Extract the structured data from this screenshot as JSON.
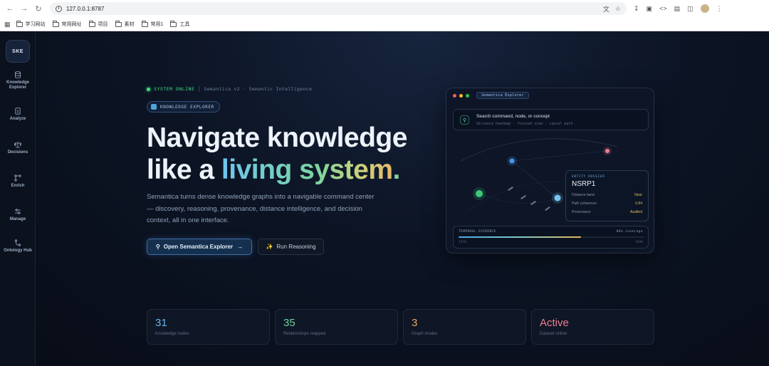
{
  "browser": {
    "url": "127.0.0.1:8787",
    "bookmarks": [
      "学习网站",
      "常用网址",
      "项目",
      "素材",
      "常用1",
      "工具"
    ]
  },
  "sidebar": {
    "logo": "SKE",
    "items": [
      {
        "label": "Knowledge Explorer",
        "icon": "database-icon"
      },
      {
        "label": "Analyze",
        "icon": "document-icon"
      },
      {
        "label": "Decisions",
        "icon": "scale-icon"
      },
      {
        "label": "Enrich",
        "icon": "graph-nodes-icon"
      },
      {
        "label": "Manage",
        "icon": "sliders-icon"
      },
      {
        "label": "Ontology Hub",
        "icon": "branch-icon"
      }
    ]
  },
  "hero": {
    "status": "SYSTEM ONLINE",
    "status_sub": "Semantica v2 · Semantic Intelligence",
    "pill": "KNOWLEDGE EXPLORER",
    "headline_line1": "Navigate knowledge",
    "headline_line2_prefix": "like a ",
    "headline_line2_highlight": "living system",
    "headline_line2_suffix": ".",
    "lead": "Semantica turns dense knowledge graphs into a navigable command center — discovery, reasoning, provenance, distance intelligence, and decision context, all in one interface.",
    "primary_button": "Open Semantica Explorer",
    "secondary_button": "Run Reasoning"
  },
  "explorer": {
    "tag": "Semantica Explorer",
    "search_title": "Search command, node, or concept",
    "search_sub": "distance heatmap · focused view · causal path",
    "dossier": {
      "label": "ENTITY DOSSIER",
      "name": "NSRP1",
      "rows": [
        {
          "k": "Distance band",
          "v": "Near"
        },
        {
          "k": "Path coherence",
          "v": "0.84"
        },
        {
          "k": "Provenance",
          "v": "Audited"
        }
      ]
    },
    "evidence": {
      "label": "TEMPORAL EVIDENCE",
      "coverage": "66% coverage",
      "coverage_fraction": 0.66,
      "start": "1970",
      "end": "2030"
    }
  },
  "stats": [
    {
      "value": "31",
      "label": "Knowledge nodes",
      "color": "#6ab4ec"
    },
    {
      "value": "35",
      "label": "Relationships mapped",
      "color": "#6fd0a0"
    },
    {
      "value": "3",
      "label": "Graph modes",
      "color": "#e6a85a"
    },
    {
      "value": "Active",
      "label": "Dataset online",
      "color": "#ee7f93"
    }
  ],
  "colors": {
    "accent": "#3f6fa6",
    "online": "#3ddc84",
    "background": "#0a0f1a"
  }
}
